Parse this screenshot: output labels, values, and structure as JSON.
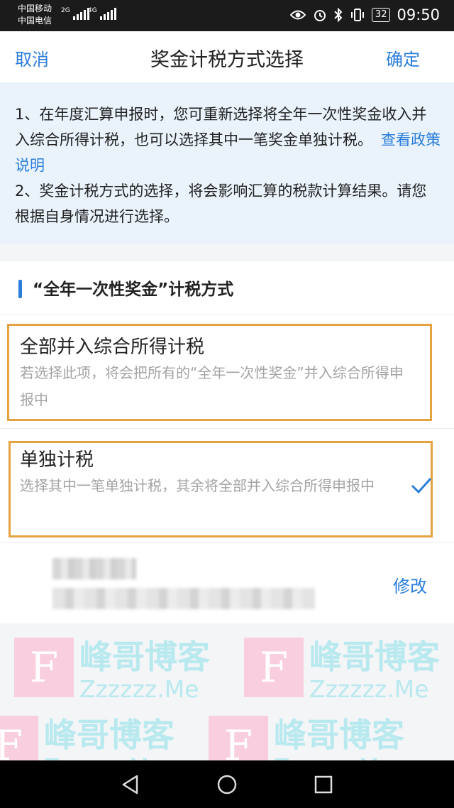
{
  "status": {
    "carrier1": "中国移动",
    "carrier2": "中国电信",
    "net1": "2G",
    "net2": "4G",
    "battery": "32",
    "time": "09:50",
    "icons": [
      "eye-icon",
      "alarm-icon",
      "bluetooth-icon",
      "vibrate-icon"
    ]
  },
  "nav": {
    "cancel": "取消",
    "title": "奖金计税方式选择",
    "confirm": "确定"
  },
  "notice": {
    "line1": "1、在年度汇算申报时，您可重新选择将全年一次性奖金收入并入综合所得计税，也可以选择其中一笔奖金单独计税。",
    "link": "查看政策说明",
    "line2": "2、奖金计税方式的选择，将会影响汇算的税款计算结果。请您根据自身情况进行选择。"
  },
  "section": {
    "title": "“全年一次性奖金”计税方式"
  },
  "options": [
    {
      "title": "全部并入综合所得计税",
      "desc": "若选择此项，将会把所有的“全年一次性奖金”并入综合所得申报中",
      "selected": false
    },
    {
      "title": "单独计税",
      "desc": "选择其中一笔单独计税，其余将全部并入综合所得申报中",
      "selected": true
    }
  ],
  "record": {
    "edit": "修改"
  },
  "watermark": {
    "logo": "F",
    "cn": "峰哥博客",
    "en": "Zzzzzz.Me"
  },
  "colors": {
    "accent": "#2a7ddc",
    "highlight_frame": "#e4a240",
    "notice_bg": "#eaf3fc",
    "muted_text": "#a3a3a3"
  }
}
